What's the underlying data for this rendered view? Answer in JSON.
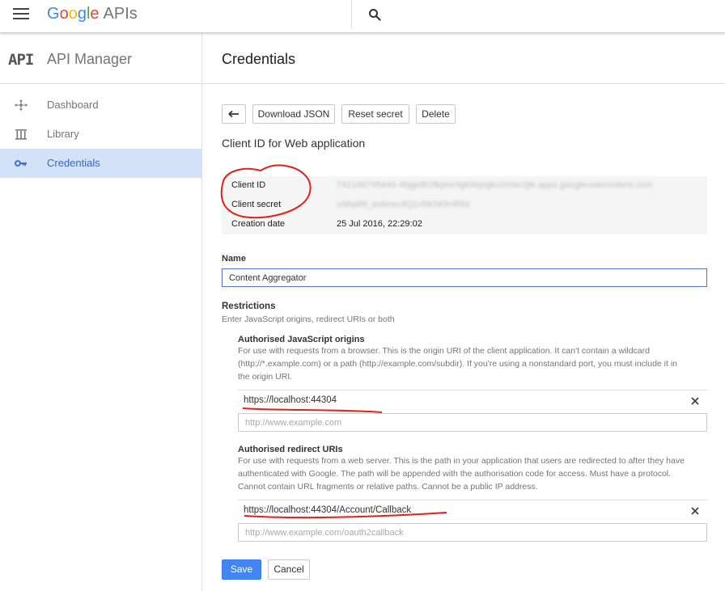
{
  "header": {
    "brand_letters": [
      "G",
      "o",
      "o",
      "g",
      "l",
      "e"
    ],
    "brand_suffix": "APIs",
    "search_icon": "search-icon",
    "menu_icon": "menu-icon"
  },
  "sidebar": {
    "logo_text": "API",
    "title": "API Manager",
    "items": [
      {
        "label": "Dashboard",
        "icon": "dashboard-icon"
      },
      {
        "label": "Library",
        "icon": "library-icon"
      },
      {
        "label": "Credentials",
        "icon": "key-icon",
        "active": true
      }
    ]
  },
  "main": {
    "title": "Credentials",
    "toolbar": {
      "back_icon": "back-arrow-icon",
      "download_label": "Download JSON",
      "reset_label": "Reset secret",
      "delete_label": "Delete"
    },
    "subtitle": "Client ID for Web application",
    "info": [
      {
        "key": "Client ID",
        "value": "742169795440-4bjgrdh2fkpnv3gl04qvgkv2mlsr2jtk.apps.googleusercontent.com",
        "obscured": true
      },
      {
        "key": "Client secret",
        "value": "uNhpl9f_eubnsc4Q1n5KhKfmRbz",
        "obscured": true
      },
      {
        "key": "Creation date",
        "value": "25 Jul 2016, 22:29:02",
        "obscured": false
      }
    ],
    "name": {
      "label": "Name",
      "value": "Content Aggregator"
    },
    "restrictions": {
      "label": "Restrictions",
      "help": "Enter JavaScript origins, redirect URIs or both",
      "origins": {
        "label": "Authorised JavaScript origins",
        "help": "For use with requests from a browser. This is the origin URI of the client application. It can't contain a wildcard (http://*.example.com) or a path (http://example.com/subdir). If you're using a nonstandard port, you must include it in the origin URI.",
        "help_lines": [
          "For use with requests from a browser. This is the origin URI of the client application. It can't contain a wildcard",
          "(http://*.example.com) or a path (http://example.com/subdir). If you're using a nonstandard port, you must include it in",
          "the origin URI."
        ],
        "entries": [
          "https://localhost:44304"
        ],
        "placeholder": "http://www.example.com"
      },
      "redirects": {
        "label": "Authorised redirect URIs",
        "help_lines": [
          "For use with requests from a web server. This is the path in your application that users are redirected to after they have",
          "authenticated with Google. The path will be appended with the authorisation code for access. Must have a protocol.",
          "Cannot contain URL fragments or relative paths. Cannot be a public IP address."
        ],
        "entries": [
          "https://localhost:44304/Account/Callback"
        ],
        "placeholder": "http://www.example.com/oauth2callback"
      }
    },
    "save_label": "Save",
    "cancel_label": "Cancel"
  },
  "colors": {
    "accent": "#4285f4",
    "active_bg": "#d3e1f9",
    "active_text": "#3367d6",
    "annotation": "#e0201b"
  }
}
